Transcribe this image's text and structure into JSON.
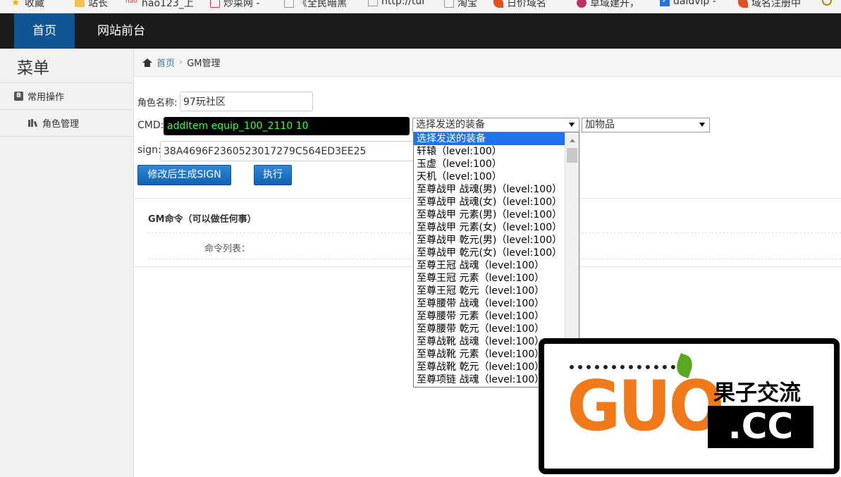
{
  "bookmarks": [
    {
      "label": "收藏",
      "icon": "star-icon",
      "color": "#f5b400"
    },
    {
      "label": "站长",
      "icon": "folder-icon",
      "color": "#f2c14e"
    },
    {
      "label": "hao123_上",
      "icon": "hao123-icon",
      "color": "#e03b2f"
    },
    {
      "label": "炒菜网 -",
      "icon": "site-icon",
      "color": "#d33"
    },
    {
      "label": "《全民暗黑",
      "icon": "page-icon",
      "color": "#999"
    },
    {
      "label": "http://tur",
      "icon": "page-icon",
      "color": "#999"
    },
    {
      "label": "淘宝",
      "icon": "page-icon",
      "color": "#999"
    },
    {
      "label": "日价域名",
      "icon": "feather-icon",
      "color": "#e05020"
    },
    {
      "label": "草域建开，",
      "icon": "flower-icon",
      "color": "#c0306a"
    },
    {
      "label": "daidvip -",
      "icon": "checkbox-icon",
      "color": "#2b6fd6"
    },
    {
      "label": "域名注册中",
      "icon": "feather-icon",
      "color": "#e05020"
    }
  ],
  "topnav": {
    "home": "首页",
    "front": "网站前台"
  },
  "sidebar": {
    "title": "菜单",
    "group": "常用操作",
    "item": "角色管理"
  },
  "breadcrumb": {
    "home": "首页",
    "current": "GM管理"
  },
  "form": {
    "role_label": "角色名称:",
    "role_value": "97玩社区",
    "cmd_label": "CMD:",
    "cmd_value": "addItem equip_100_2110 10",
    "equip_select": "选择发送的装备",
    "action_select": "加物品",
    "sign_label": "sign:",
    "sign_value": "38A4696F2360523017279C564ED3EE25",
    "gen_button": "修改后生成SIGN",
    "run_button": "执行"
  },
  "panel": {
    "title": "GM命令（可以做任何事）",
    "list_label": "命令列表："
  },
  "dropdown_options": [
    "选择发送的装备",
    "轩辕（level:100）",
    "玉虚（level:100）",
    "天机（level:100）",
    "至尊战甲 战魂(男)（level:100）",
    "至尊战甲 战魂(女)（level:100）",
    "至尊战甲 元素(男)（level:100）",
    "至尊战甲 元素(女)（level:100）",
    "至尊战甲 乾元(男)（level:100）",
    "至尊战甲 乾元(女)（level:100）",
    "至尊王冠 战魂（level:100）",
    "至尊王冠 元素（level:100）",
    "至尊王冠 乾元（level:100）",
    "至尊腰带 战魂（level:100）",
    "至尊腰带 元素（level:100）",
    "至尊腰带 乾元（level:100）",
    "至尊战靴 战魂（level:100）",
    "至尊战靴 元素（level:100）",
    "至尊战靴 乾元（level:100）",
    "至尊项链 战魂（level:100）"
  ],
  "watermark": {
    "brand": "GUO",
    "cn": "果子交流",
    "domain": ".CC",
    "accent": "#f07a1a"
  }
}
